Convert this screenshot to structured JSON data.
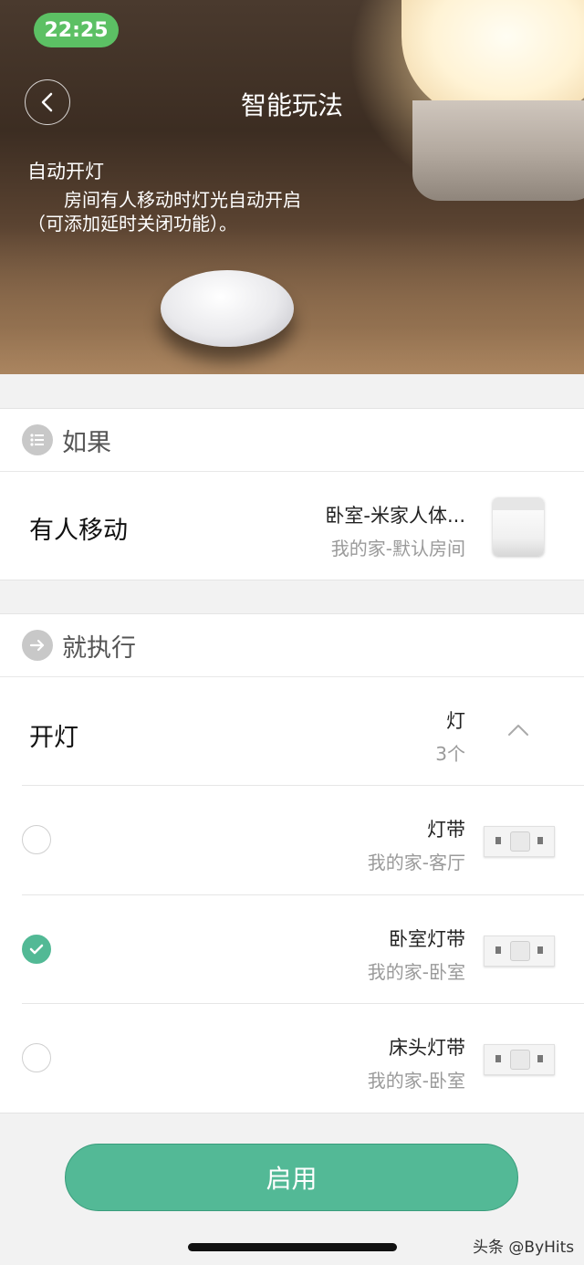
{
  "status_bar": {
    "time": "22:25"
  },
  "header": {
    "title": "智能玩法",
    "heading": "自动开灯",
    "description": "房间有人移动时灯光自动开启（可添加延时关闭功能）。"
  },
  "if_section": {
    "title": "如果",
    "trigger": {
      "label": "有人移动",
      "device_name": "卧室-米家人体...",
      "device_location": "我的家-默认房间"
    }
  },
  "then_section": {
    "title": "就执行",
    "action": {
      "label": "开灯",
      "device_type": "灯",
      "device_count": "3个"
    },
    "devices": [
      {
        "name": "灯带",
        "location": "我的家-客厅",
        "checked": false
      },
      {
        "name": "卧室灯带",
        "location": "我的家-卧室",
        "checked": true
      },
      {
        "name": "床头灯带",
        "location": "我的家-卧室",
        "checked": false
      }
    ]
  },
  "footer": {
    "enable_label": "启用"
  },
  "watermark": "头条 @ByHits",
  "colors": {
    "accent": "#53b996",
    "status_pill": "#5cc064"
  }
}
